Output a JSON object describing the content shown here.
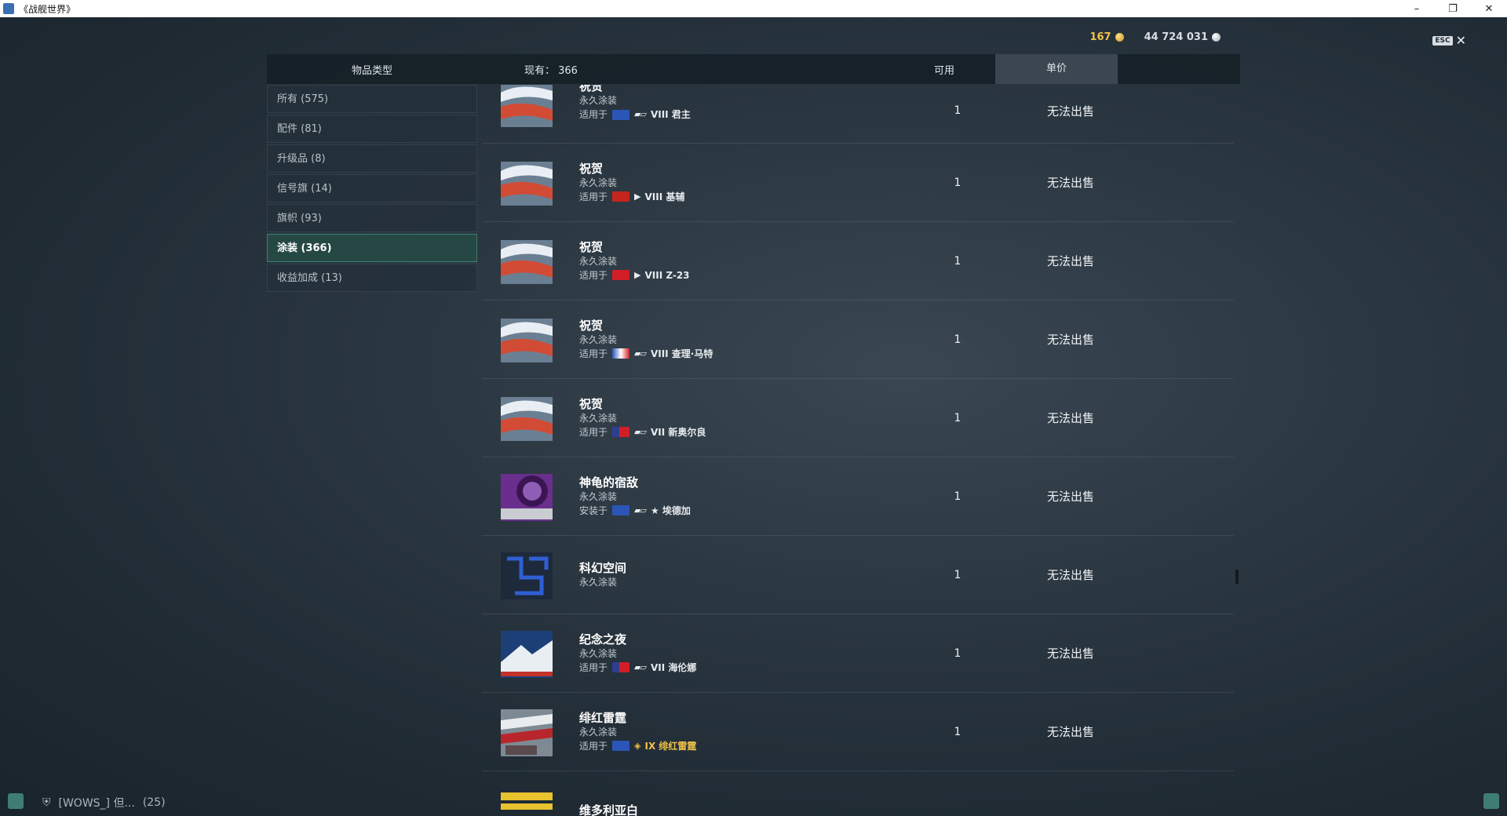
{
  "window": {
    "title": "《战舰世界》",
    "min": "–",
    "max": "❐",
    "close": "✕"
  },
  "currency": {
    "gold": "167",
    "silver": "44 724 031",
    "gold_color": "#f1c24a"
  },
  "esc": {
    "key": "ESC",
    "close": "✕"
  },
  "header": {
    "type_label": "物品类型",
    "count_label": "现有： 366",
    "avail_label": "可用",
    "price_label": "单价"
  },
  "categories": [
    {
      "label": "所有 (575)"
    },
    {
      "label": "配件 (81)"
    },
    {
      "label": "升级品 (8)"
    },
    {
      "label": "信号旗 (14)"
    },
    {
      "label": "旗帜 (93)"
    },
    {
      "label": "涂装 (366)"
    },
    {
      "label": "收益加成 (13)"
    }
  ],
  "items": [
    {
      "name": "祝贺",
      "sub": "永久涂装",
      "fit_label": "适用于",
      "ship": "VIII 君主",
      "avail": "1",
      "price": "无法出售",
      "flag": "uk",
      "icon": "congrats-camo-icon"
    },
    {
      "name": "祝贺",
      "sub": "永久涂装",
      "fit_label": "适用于",
      "ship": "VIII 基辅",
      "avail": "1",
      "price": "无法出售",
      "flag": "ussr",
      "icon": "congrats-camo-icon"
    },
    {
      "name": "祝贺",
      "sub": "永久涂装",
      "fit_label": "适用于",
      "ship": "VIII Z-23",
      "avail": "1",
      "price": "无法出售",
      "flag": "germany",
      "icon": "congrats-camo-icon"
    },
    {
      "name": "祝贺",
      "sub": "永久涂装",
      "fit_label": "适用于",
      "ship": "VIII 查理·马特",
      "avail": "1",
      "price": "无法出售",
      "flag": "france",
      "icon": "congrats-camo-icon"
    },
    {
      "name": "祝贺",
      "sub": "永久涂装",
      "fit_label": "适用于",
      "ship": "VII 新奥尔良",
      "avail": "1",
      "price": "无法出售",
      "flag": "usa",
      "icon": "congrats-camo-icon"
    },
    {
      "name": "神龟的宿敌",
      "sub": "永久涂装",
      "fit_label": "安装于",
      "ship": "★ 埃德加",
      "avail": "1",
      "price": "无法出售",
      "flag": "uk",
      "icon": "turtle-nemesis-camo-icon"
    },
    {
      "name": "科幻空间",
      "sub": "永久涂装",
      "fit_label": "",
      "ship": "",
      "avail": "1",
      "price": "无法出售",
      "flag": "",
      "icon": "scifi-space-camo-icon"
    },
    {
      "name": "纪念之夜",
      "sub": "永久涂装",
      "fit_label": "适用于",
      "ship": "VII 海伦娜",
      "avail": "1",
      "price": "无法出售",
      "flag": "usa",
      "icon": "memorial-night-camo-icon"
    },
    {
      "name": "绯红雷霆",
      "sub": "永久涂装",
      "fit_label": "适用于",
      "ship": "IX 绯红雷霆",
      "avail": "1",
      "price": "无法出售",
      "flag": "uk",
      "icon": "crimson-thunder-camo-icon"
    },
    {
      "name": "维多利亚白",
      "sub": "",
      "fit_label": "",
      "ship": "",
      "avail": "",
      "price": "",
      "flag": "",
      "icon": "victoria-white-camo-icon"
    }
  ],
  "bottom": {
    "clan": "[WOWS_]  但...",
    "count": "(25)"
  }
}
